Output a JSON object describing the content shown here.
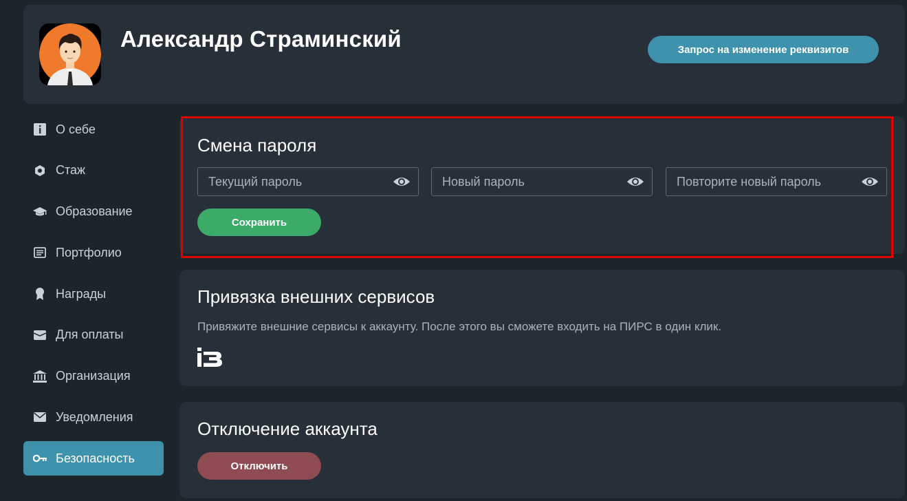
{
  "profile": {
    "name": "Александр Страминский",
    "requisites_button": "Запрос на изменение реквизитов"
  },
  "sidebar": {
    "items": [
      {
        "label": "О себе",
        "icon": "info-icon"
      },
      {
        "label": "Стаж",
        "icon": "hexagon-icon"
      },
      {
        "label": "Образование",
        "icon": "graduation-cap-icon"
      },
      {
        "label": "Портфолио",
        "icon": "document-list-icon"
      },
      {
        "label": "Награды",
        "icon": "award-icon"
      },
      {
        "label": "Для оплаты",
        "icon": "wallet-icon"
      },
      {
        "label": "Организация",
        "icon": "bank-icon"
      },
      {
        "label": "Уведомления",
        "icon": "envelope-icon"
      },
      {
        "label": "Безопасность",
        "icon": "key-icon",
        "active": true
      }
    ]
  },
  "password_section": {
    "title": "Смена пароля",
    "current_placeholder": "Текущий пароль",
    "new_placeholder": "Новый пароль",
    "repeat_placeholder": "Повторите новый пароль",
    "save_button": "Сохранить"
  },
  "services_section": {
    "title": "Привязка внешних сервисов",
    "description": "Привяжите внешние сервисы к аккаунту. После этого вы сможете входить на ПИРС в один клик."
  },
  "disable_section": {
    "title": "Отключение аккаунта",
    "disable_button": "Отключить"
  },
  "colors": {
    "background": "#1c252c",
    "card": "#273038",
    "accent": "#3e92ac",
    "save": "#3caa68",
    "danger": "#8e4c52",
    "highlight": "#e00000"
  }
}
